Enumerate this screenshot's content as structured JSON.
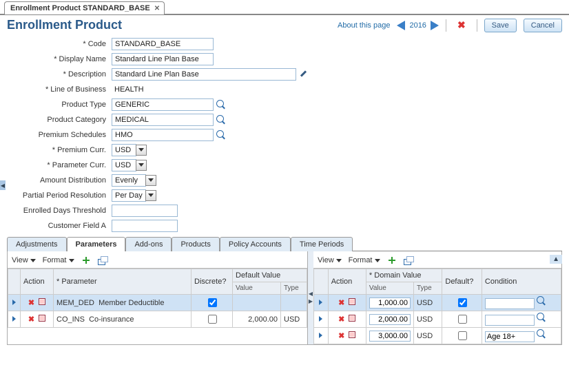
{
  "tab_title": "Enrollment Product STANDARD_BASE",
  "page_title": "Enrollment Product",
  "header": {
    "about_link": "About this page",
    "year": "2016",
    "save": "Save",
    "cancel": "Cancel"
  },
  "form": {
    "code": {
      "label": "Code",
      "value": "STANDARD_BASE"
    },
    "display_name": {
      "label": "Display Name",
      "value": "Standard Line Plan Base"
    },
    "description": {
      "label": "Description",
      "value": "Standard Line Plan Base"
    },
    "line_of_business": {
      "label": "Line of Business",
      "value": "HEALTH"
    },
    "product_type": {
      "label": "Product Type",
      "value": "GENERIC"
    },
    "product_category": {
      "label": "Product Category",
      "value": "MEDICAL"
    },
    "premium_schedules": {
      "label": "Premium Schedules",
      "value": "HMO"
    },
    "premium_curr": {
      "label": "Premium Curr.",
      "value": "USD"
    },
    "parameter_curr": {
      "label": "Parameter Curr.",
      "value": "USD"
    },
    "amount_distribution": {
      "label": "Amount Distribution",
      "value": "Evenly"
    },
    "partial_period_resolution": {
      "label": "Partial Period Resolution",
      "value": "Per Day"
    },
    "enrolled_days_threshold": {
      "label": "Enrolled Days Threshold",
      "value": ""
    },
    "customer_field_a": {
      "label": "Customer Field A",
      "value": ""
    }
  },
  "lower_tabs": [
    "Adjustments",
    "Parameters",
    "Add-ons",
    "Products",
    "Policy Accounts",
    "Time Periods"
  ],
  "lower_tabs_active": 1,
  "toolbar": {
    "view": "View",
    "format": "Format"
  },
  "grid_left": {
    "headers": {
      "action": "Action",
      "parameter": "* Parameter",
      "discrete": "Discrete?",
      "default_value": "Default Value",
      "value": "Value",
      "type": "Type"
    },
    "rows": [
      {
        "code": "MEM_DED",
        "name": "Member Deductible",
        "discrete": true,
        "value": "",
        "type": "",
        "selected": true
      },
      {
        "code": "CO_INS",
        "name": "Co-insurance",
        "discrete": false,
        "value": "2,000.00",
        "type": "USD",
        "selected": false
      }
    ]
  },
  "grid_right": {
    "headers": {
      "action": "Action",
      "domain_value": "* Domain Value",
      "value": "Value",
      "type": "Type",
      "default": "Default?",
      "condition": "Condition"
    },
    "rows": [
      {
        "value": "1,000.00",
        "type": "USD",
        "default": true,
        "condition": "",
        "selected": true
      },
      {
        "value": "2,000.00",
        "type": "USD",
        "default": false,
        "condition": "",
        "selected": false
      },
      {
        "value": "3,000.00",
        "type": "USD",
        "default": false,
        "condition": "Age 18+",
        "selected": false
      }
    ]
  }
}
